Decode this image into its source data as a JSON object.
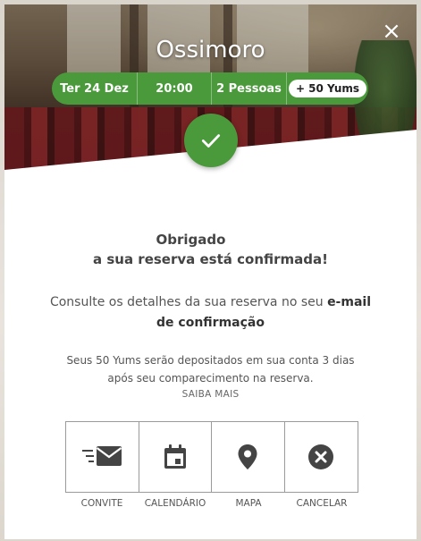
{
  "header": {
    "restaurant_name": "Ossimoro",
    "close_symbol": "×"
  },
  "booking": {
    "date": "Ter 24 Dez",
    "time": "20:00",
    "guests": "2 Pessoas",
    "yums_badge": "+ 50 Yums"
  },
  "confirmation": {
    "line1": "Obrigado",
    "line2": "a sua reserva está confirmada!",
    "consult_text": "Consulte os detalhes da sua reserva no seu ",
    "consult_bold": "e-mail de confirmação",
    "yums_info": "Seus 50 Yums serão depositados em sua conta 3 dias após seu comparecimento na reserva.",
    "learn_more": "SAIBA MAIS"
  },
  "actions": [
    {
      "label": "CONVITE",
      "icon": "envelope-icon"
    },
    {
      "label": "CALENDÁRIO",
      "icon": "calendar-icon"
    },
    {
      "label": "MAPA",
      "icon": "map-pin-icon"
    },
    {
      "label": "CANCELAR",
      "icon": "cancel-icon"
    }
  ],
  "colors": {
    "accent_green": "#4a9a3c",
    "icon_dark": "#444444"
  }
}
